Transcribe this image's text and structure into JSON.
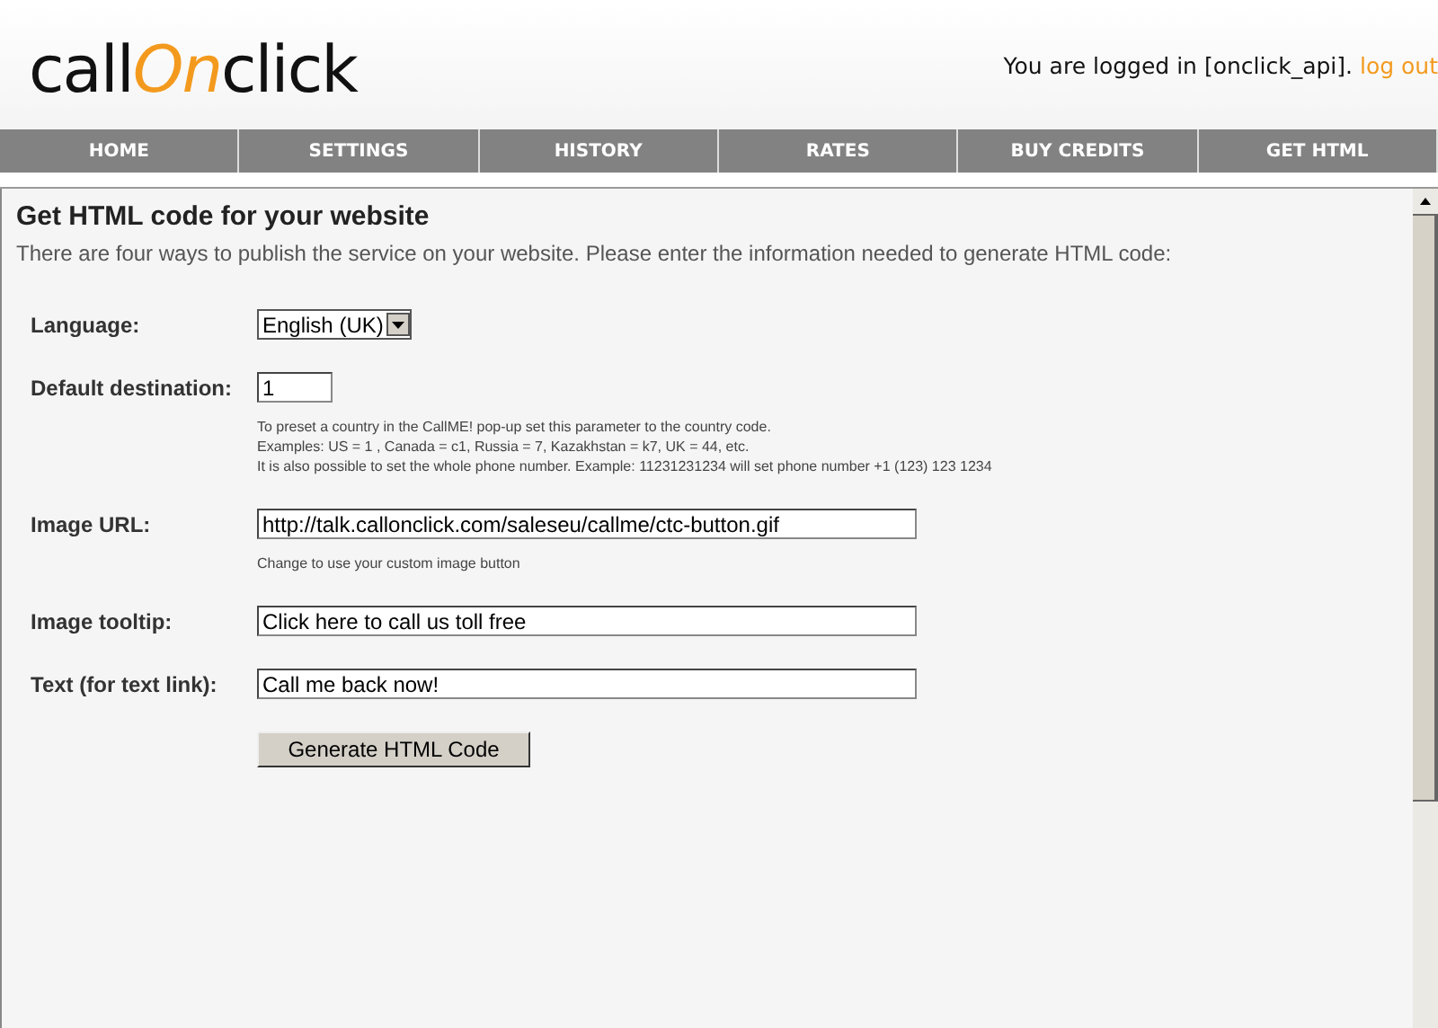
{
  "logo": {
    "lead": "call",
    "accent": "On",
    "tail": "click"
  },
  "login": {
    "text": "You are logged in [onclick_api].",
    "link": "log out"
  },
  "nav": [
    "HOME",
    "SETTINGS",
    "HISTORY",
    "RATES",
    "BUY CREDITS",
    "GET HTML"
  ],
  "page": {
    "title": "Get HTML code for your website",
    "intro": "There are four ways to publish the service on your website. Please enter the information needed to generate HTML code:"
  },
  "fields": [
    {
      "kind": "select",
      "label": "Language:",
      "value": "English (UK)"
    },
    {
      "kind": "input",
      "label": "Default destination:",
      "value": "1",
      "help": [
        "To preset a country in the CallME! pop-up set this parameter to the country code.",
        "Examples: US = 1 , Canada = c1, Russia = 7, Kazakhstan = k7, UK = 44, etc.",
        "It is also possible to set the whole phone number. Example: 11231231234 will set phone number +1 (123) 123 1234"
      ]
    },
    {
      "kind": "input",
      "label": "Image URL:",
      "value": "http://talk.callonclick.com/saleseu/callme/ctc-button.gif",
      "help": [
        "Change to use your custom image button"
      ]
    },
    {
      "kind": "input",
      "label": "Image tooltip:",
      "value": "Click here to call us toll free"
    },
    {
      "kind": "input",
      "label": "Text (for text link):",
      "value": "Call me back now!"
    }
  ],
  "button": "Generate HTML Code"
}
